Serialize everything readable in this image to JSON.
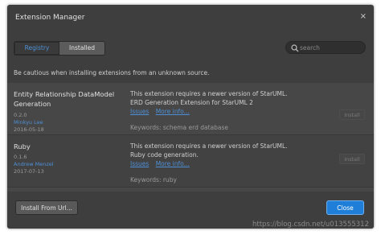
{
  "dialog": {
    "title": "Extension Manager",
    "close_glyph": "×"
  },
  "tabs": [
    {
      "label": "Registry",
      "active": true
    },
    {
      "label": "Installed",
      "active": false
    }
  ],
  "search": {
    "placeholder": "search",
    "icon": "search-icon"
  },
  "notice": "Be cautious when installing extensions from an unknown source.",
  "extensions": [
    {
      "name": "Entity Relationship DataModel Generation",
      "version": "0.2.0",
      "author": "Minkyu Lee",
      "date": "2016-05-18",
      "description_line1": "This extension requires a newer version of StarUML.",
      "description_line2": "ERD Generation Extension for StarUML 2",
      "link_issues": "Issues",
      "link_more": "More info...",
      "keywords": "Keywords: schema erd database",
      "install_label": "Install"
    },
    {
      "name": "Ruby",
      "version": "0.1.6",
      "author": "Andrew Menzel",
      "date": "2017-07-13",
      "description_line1": "This extension requires a newer version of StarUML.",
      "description_line2": "Ruby code generation.",
      "link_issues": "Issues",
      "link_more": "More info...",
      "keywords": "Keywords: ruby",
      "install_label": "Install"
    }
  ],
  "footer": {
    "install_url_label": "Install From Url...",
    "close_label": "Close"
  },
  "watermark": "https://blog.csdn.net/u013555312",
  "colors": {
    "dialog_bg": "#3e3e3e",
    "accent_blue": "#1f7fd8",
    "link_blue": "#4d8fd6"
  }
}
